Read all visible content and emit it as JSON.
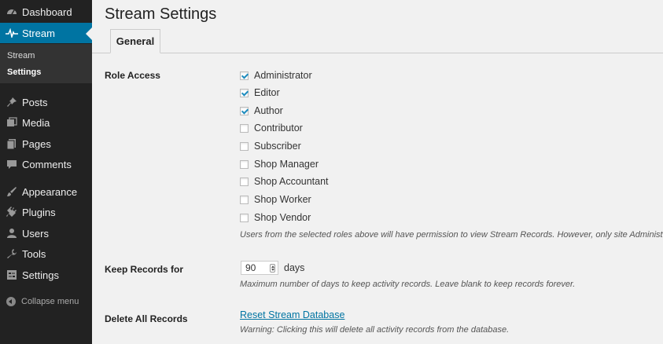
{
  "sidebar": {
    "items": [
      {
        "label": "Dashboard",
        "icon": "dashboard-icon"
      },
      {
        "label": "Stream",
        "icon": "stream-pulse-icon",
        "active": true
      },
      {
        "label": "Posts",
        "icon": "pin-icon"
      },
      {
        "label": "Media",
        "icon": "media-icon"
      },
      {
        "label": "Pages",
        "icon": "pages-icon"
      },
      {
        "label": "Comments",
        "icon": "comment-icon"
      },
      {
        "label": "Appearance",
        "icon": "brush-icon"
      },
      {
        "label": "Plugins",
        "icon": "plug-icon"
      },
      {
        "label": "Users",
        "icon": "user-icon"
      },
      {
        "label": "Tools",
        "icon": "wrench-icon"
      },
      {
        "label": "Settings",
        "icon": "settings-icon"
      }
    ],
    "submenu": [
      {
        "label": "Stream"
      },
      {
        "label": "Settings",
        "current": true
      }
    ],
    "collapse_label": "Collapse menu"
  },
  "main": {
    "title": "Stream Settings",
    "tabs": [
      {
        "label": "General",
        "active": true
      }
    ],
    "role_access": {
      "label": "Role Access",
      "roles": [
        {
          "label": "Administrator",
          "checked": true
        },
        {
          "label": "Editor",
          "checked": true
        },
        {
          "label": "Author",
          "checked": true
        },
        {
          "label": "Contributor",
          "checked": false
        },
        {
          "label": "Subscriber",
          "checked": false
        },
        {
          "label": "Shop Manager",
          "checked": false
        },
        {
          "label": "Shop Accountant",
          "checked": false
        },
        {
          "label": "Shop Worker",
          "checked": false
        },
        {
          "label": "Shop Vendor",
          "checked": false
        }
      ],
      "description": "Users from the selected roles above will have permission to view Stream Records. However, only site Administr"
    },
    "keep_records": {
      "label": "Keep Records for",
      "value": "90",
      "unit": "days",
      "description": "Maximum number of days to keep activity records. Leave blank to keep records forever."
    },
    "delete_records": {
      "label": "Delete All Records",
      "link": "Reset Stream Database",
      "warning": "Warning: Clicking this will delete all activity records from the database."
    }
  },
  "colors": {
    "sidebar_bg": "#222222",
    "active_blue": "#0074a2",
    "page_bg": "#f1f1f1"
  }
}
